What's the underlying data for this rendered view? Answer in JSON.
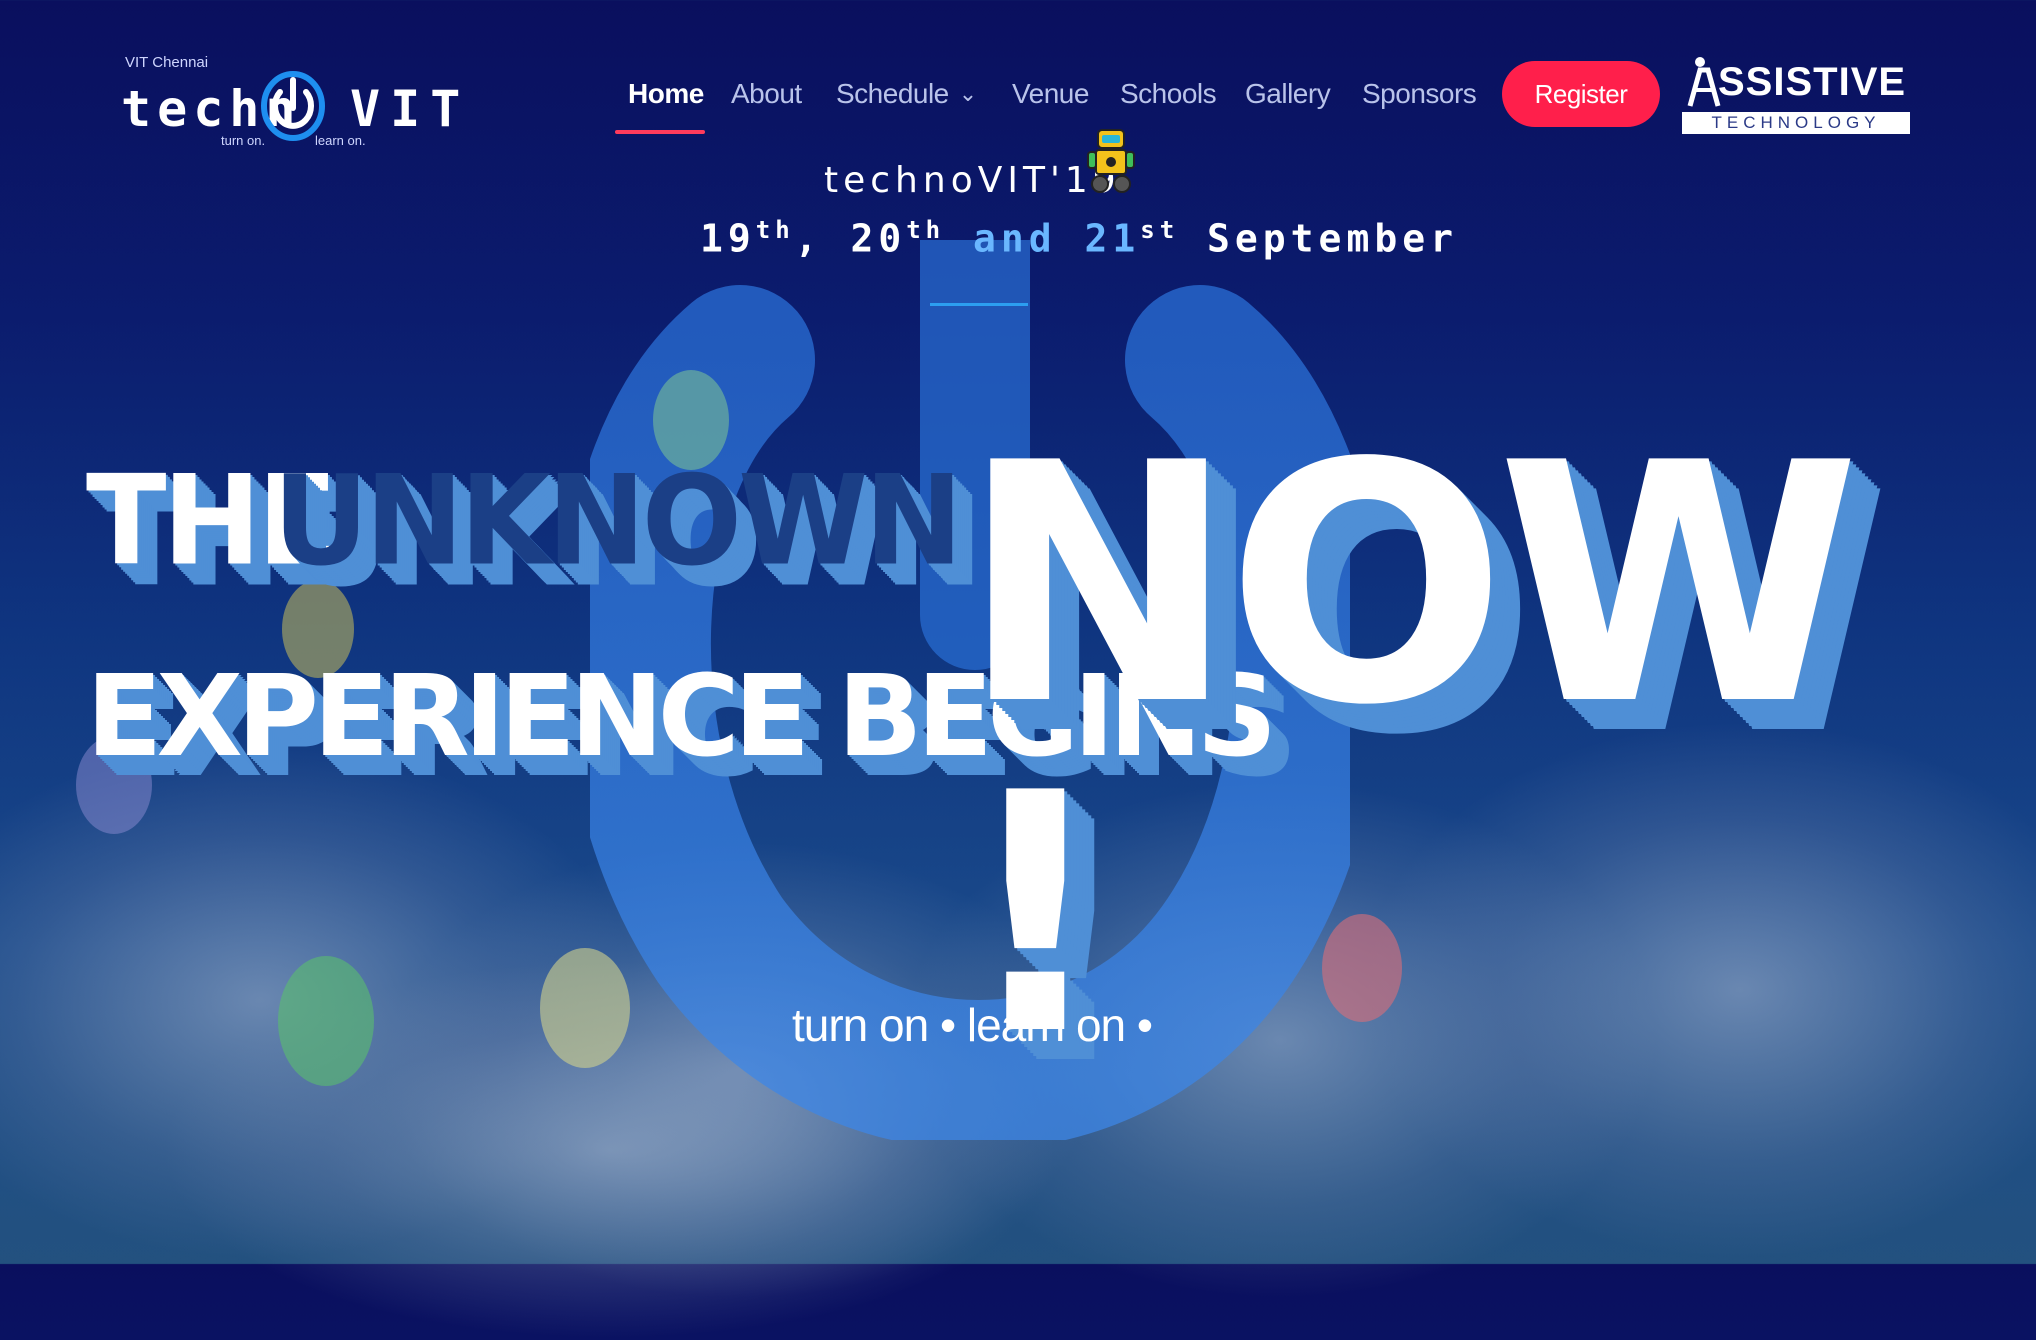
{
  "logo": {
    "org": "VIT Chennai",
    "name_left": "techn",
    "name_right": "VIT",
    "tag_left": "turn on.",
    "tag_right": "learn on."
  },
  "nav": {
    "items": [
      {
        "label": "Home",
        "active": true
      },
      {
        "label": "About"
      },
      {
        "label": "Schedule",
        "has_dropdown": true
      },
      {
        "label": "Venue"
      },
      {
        "label": "Schools"
      },
      {
        "label": "Gallery"
      },
      {
        "label": "Sponsors"
      }
    ],
    "register_label": "Register",
    "active_color": "#ff3b5c",
    "register_color": "#ff1f4b"
  },
  "sponsor_logo": {
    "word": "SSISTIVE",
    "sub": "TECHNOLOGY"
  },
  "event": {
    "title": "technoVIT'19",
    "day1": "19",
    "day1_sup": "th",
    "sep1": ", ",
    "day2": "20",
    "day2_sup": "th",
    "and": " and ",
    "day3": "21",
    "day3_sup": "st",
    "month": " September"
  },
  "hero": {
    "line1_a": "THE",
    "line1_b": "UNKNOWN",
    "line2": "EXPERIENCE BEGINS",
    "big": "NOW !",
    "tagline": "turn on • learn on •"
  },
  "colors": {
    "background_top": "#0a0f5e",
    "accent_blue": "#2c9ef0",
    "extrude_blue": "#4f8fd6"
  }
}
